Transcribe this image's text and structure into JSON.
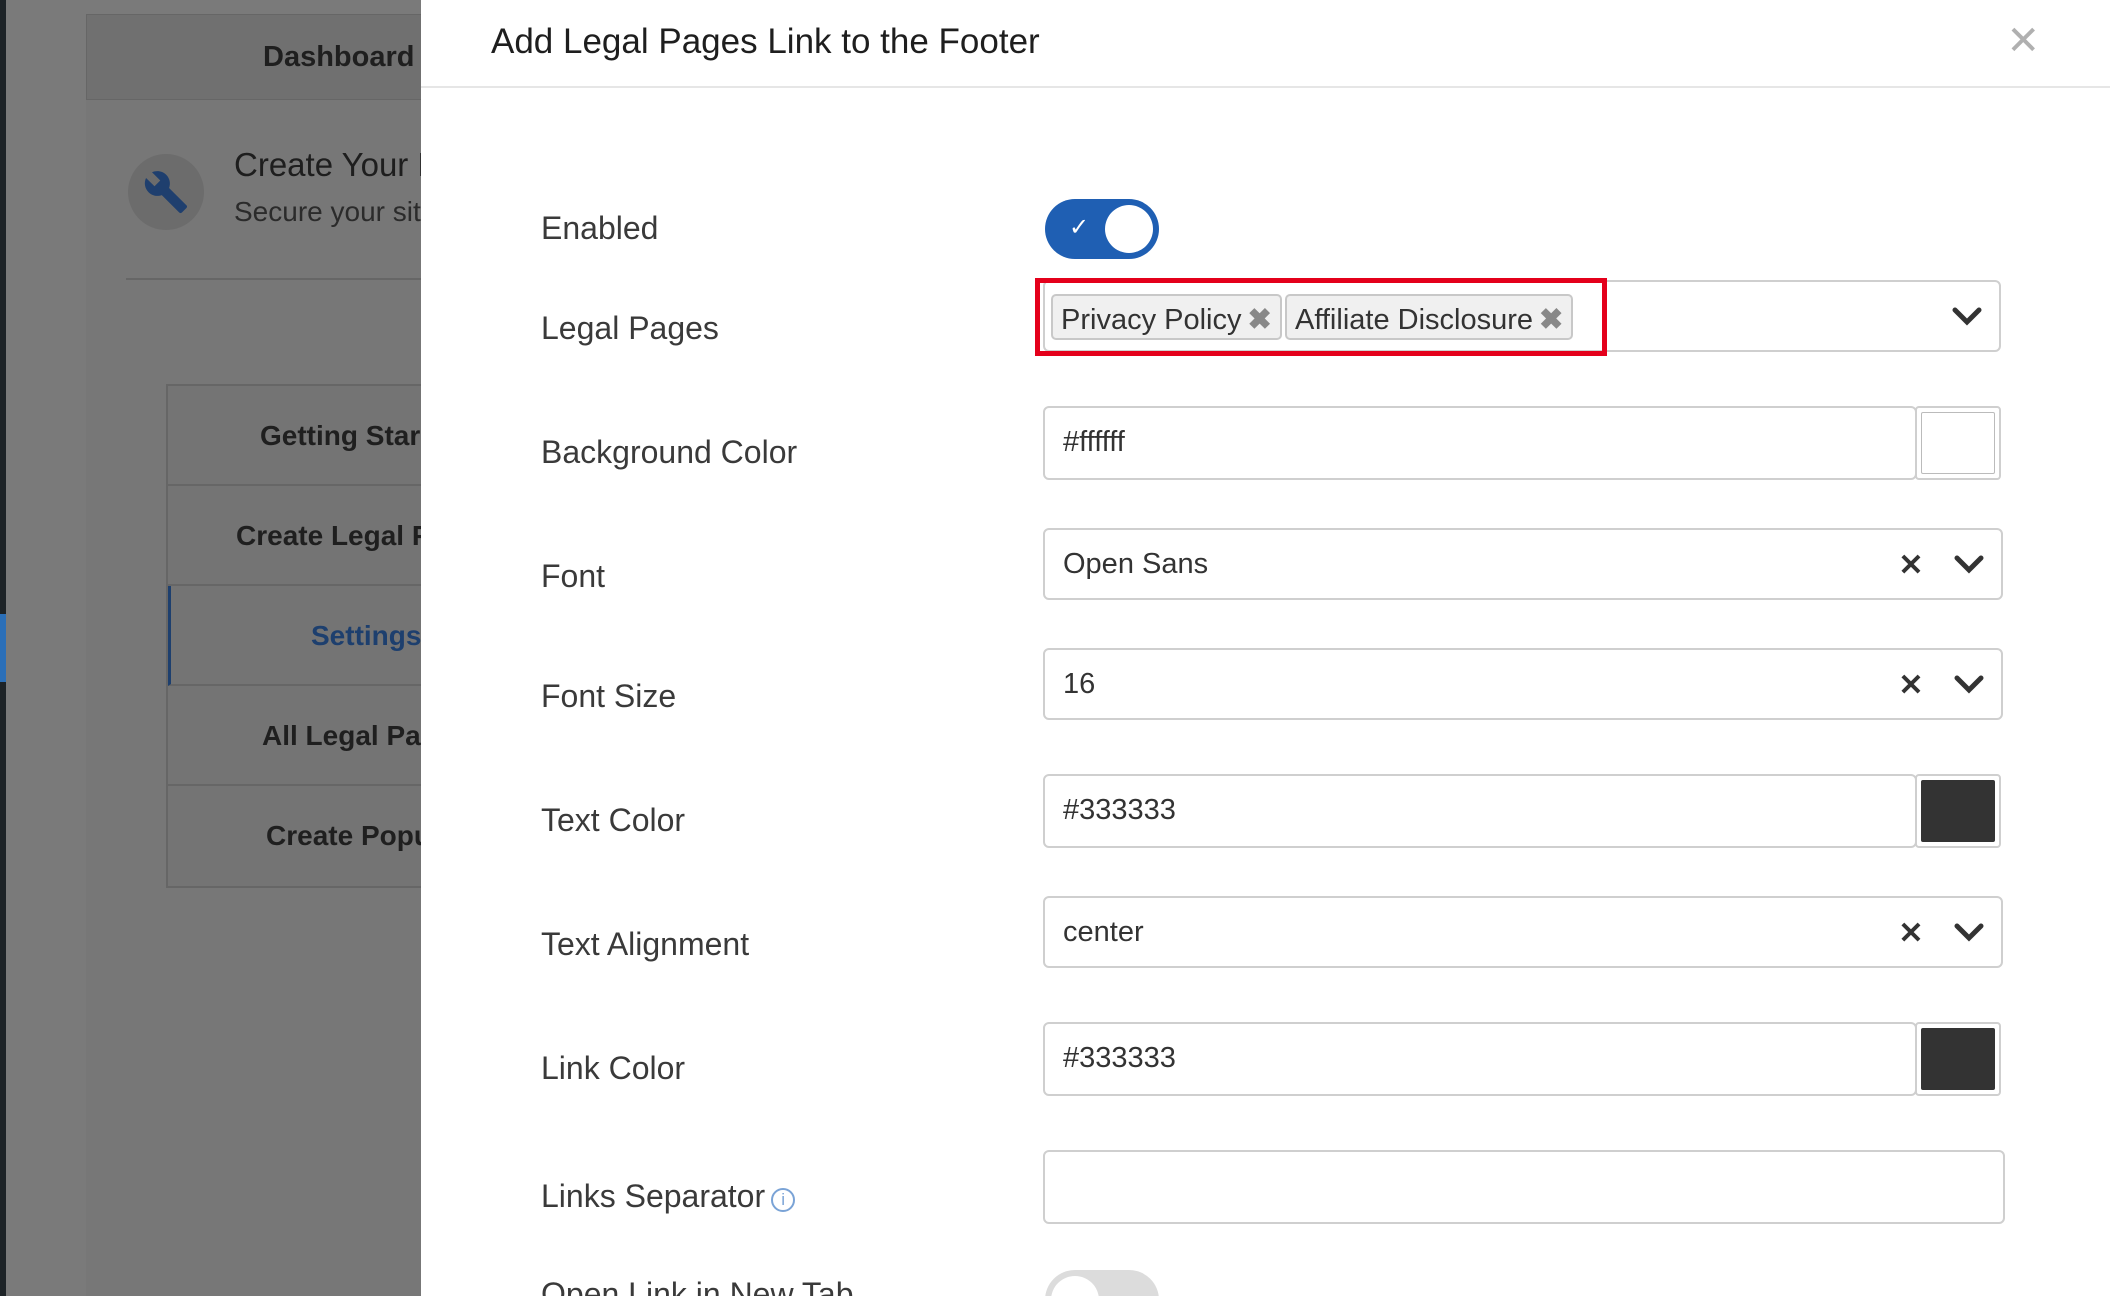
{
  "background": {
    "dashboard_label": "Dashboard",
    "card_title": "Create Your L",
    "card_subtitle": "Secure your sit",
    "nav": [
      {
        "label": "Getting Star"
      },
      {
        "label": "Create Legal P"
      },
      {
        "label": "Settings"
      },
      {
        "label": "All Legal Pag"
      },
      {
        "label": "Create Popu"
      }
    ]
  },
  "modal": {
    "title": "Add Legal Pages Link to the Footer",
    "close_icon": "close-icon"
  },
  "form": {
    "enabled": {
      "label": "Enabled",
      "value": true
    },
    "legal_pages": {
      "label": "Legal Pages",
      "tags": [
        "Privacy Policy",
        "Affiliate Disclosure"
      ],
      "remove_glyph": "✖"
    },
    "background_color": {
      "label": "Background Color",
      "value": "#ffffff",
      "swatch": "#ffffff"
    },
    "font": {
      "label": "Font",
      "value": "Open Sans"
    },
    "font_size": {
      "label": "Font Size",
      "value": "16"
    },
    "text_color": {
      "label": "Text Color",
      "value": "#333333",
      "swatch": "#333333"
    },
    "text_alignment": {
      "label": "Text Alignment",
      "value": "center"
    },
    "link_color": {
      "label": "Link Color",
      "value": "#333333",
      "swatch": "#333333"
    },
    "links_separator": {
      "label": "Links Separator",
      "value": ""
    },
    "open_new_tab": {
      "label": "Open Link in New Tab",
      "value": false
    }
  },
  "colors": {
    "accent": "#1f5fb3",
    "highlight": "#e4001b"
  }
}
